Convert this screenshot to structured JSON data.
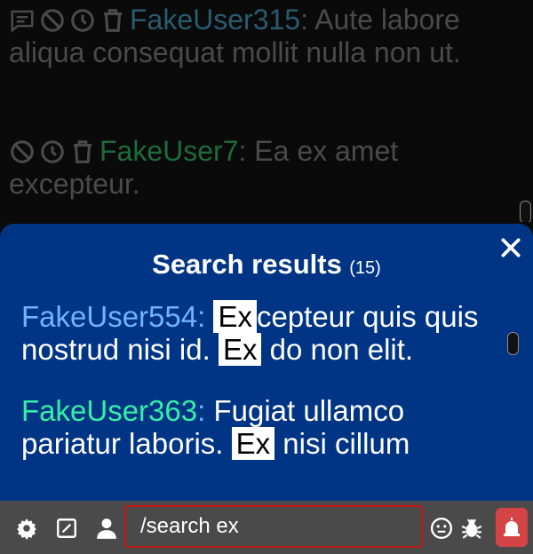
{
  "chat": {
    "messages": [
      {
        "user": "FakeUser315",
        "text": ": Aute labore aliqua consequat mollit nulla non ut.",
        "user_color": "#2a5a6e"
      },
      {
        "user": "FakeUser7",
        "text": ": Ea ex amet excepteur.",
        "user_color": "#1e6b3a"
      }
    ]
  },
  "search_panel": {
    "title": "Search results",
    "count": "(15)",
    "results": [
      {
        "user": "FakeUser554",
        "colon": ":",
        "parts": [
          "Ex",
          "cepteur quis quis nostrud nisi id. ",
          "Ex",
          " do non elit."
        ]
      },
      {
        "user": "FakeUser363",
        "colon": ":",
        "parts": [
          "Fugiat ullamco pariatur laboris. ",
          "Ex",
          " nisi cillum"
        ]
      }
    ]
  },
  "input_bar": {
    "value": "/search ex"
  },
  "icons": [
    "settings-icon",
    "edit-icon",
    "user-icon",
    "emoji-icon",
    "bug-icon",
    "alert-icon",
    "close-icon",
    "chat-icon",
    "ban-icon",
    "clock-icon",
    "trash-icon"
  ]
}
